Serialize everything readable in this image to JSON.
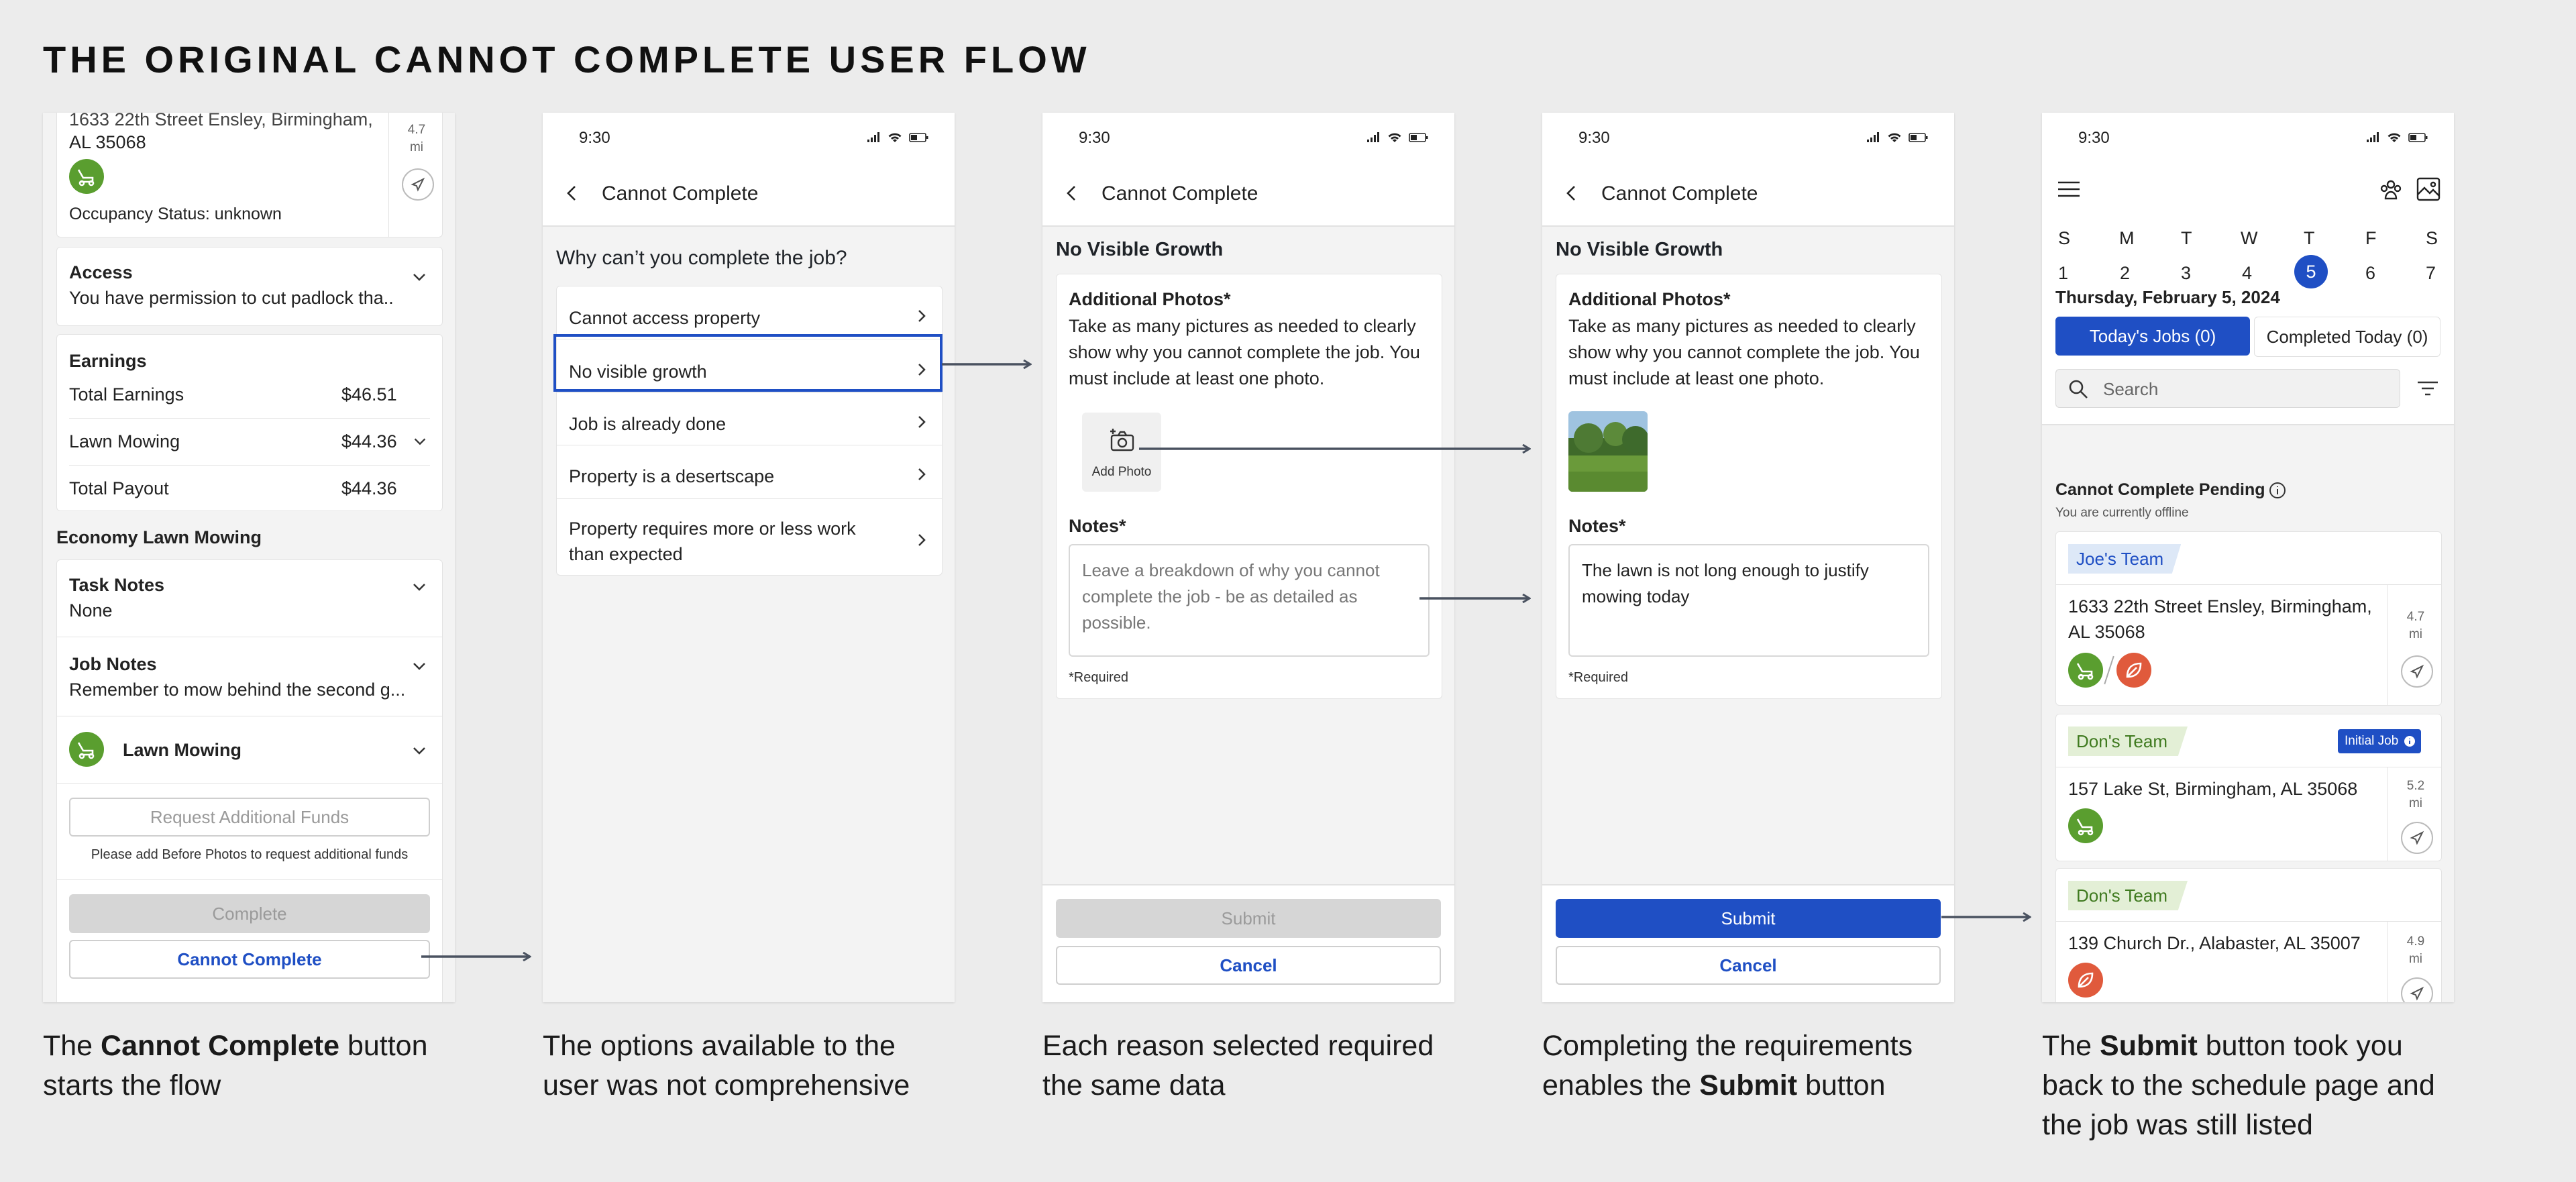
{
  "page": {
    "title": "THE ORIGINAL CANNOT COMPLETE USER FLOW"
  },
  "colors": {
    "primary": "#1f4fc4",
    "green": "#5a9e2f",
    "red": "#e05a3c",
    "highlight_border": "#1f4fc4",
    "team_tag": "#dde8f7",
    "team_tag_green": "#e3efd6"
  },
  "screen1": {
    "address_line1": "1633 22th Street Ensley, Birmingham,",
    "address_line2": "AL 35068",
    "distance_value": "4.7",
    "distance_unit": "mi",
    "occupancy": "Occupancy Status: unknown",
    "access_title": "Access",
    "access_text": "You have permission to cut padlock tha..",
    "earnings_title": "Earnings",
    "earnings": [
      {
        "label": "Total Earnings",
        "value": "$46.51"
      },
      {
        "label": "Lawn Mowing",
        "value": "$44.36"
      },
      {
        "label": "Total Payout",
        "value": "$44.36"
      }
    ],
    "section_title": "Economy Lawn Mowing",
    "task_notes_title": "Task Notes",
    "task_notes_text": "None",
    "job_notes_title": "Job Notes",
    "job_notes_text": "Remember to mow behind the second g...",
    "service_label": "Lawn Mowing",
    "request_funds_label": "Request Additional Funds",
    "request_funds_hint": "Please add Before Photos to request additional funds",
    "complete_label": "Complete",
    "cannot_complete_label": "Cannot Complete"
  },
  "screen2": {
    "time": "9:30",
    "header_title": "Cannot Complete",
    "question": "Why can’t you complete the job?",
    "options": [
      "Cannot access property",
      "No visible growth",
      "Job is already done",
      "Property is a desertscape",
      "Property requires more or less work",
      "than expected"
    ]
  },
  "screen3": {
    "time": "9:30",
    "header_title": "Cannot Complete",
    "reason_title": "No Visible Growth",
    "photos_title": "Additional Photos*",
    "photos_text_1": "Take as many pictures as needed to clearly",
    "photos_text_2": "show why you cannot complete the job. You",
    "photos_text_3": "must include at least one photo.",
    "add_photo_label": "Add Photo",
    "notes_title": "Notes*",
    "notes_placeholder_1": "Leave a breakdown of why you cannot",
    "notes_placeholder_2": "complete the job - be as detailed as",
    "notes_placeholder_3": "possible.",
    "required_label": "*Required",
    "submit_label": "Submit",
    "cancel_label": "Cancel"
  },
  "screen4": {
    "time": "9:30",
    "header_title": "Cannot Complete",
    "reason_title": "No Visible Growth",
    "photos_title": "Additional Photos*",
    "photos_text_1": "Take as many pictures as needed to clearly",
    "photos_text_2": "show why you cannot complete the job. You",
    "photos_text_3": "must include at least one photo.",
    "notes_title": "Notes*",
    "notes_value_1": "The lawn is not long enough to justify",
    "notes_value_2": "mowing today",
    "required_label": "*Required",
    "submit_label": "Submit",
    "cancel_label": "Cancel"
  },
  "screen5": {
    "time": "9:30",
    "weekdays": [
      "S",
      "M",
      "T",
      "W",
      "T",
      "F",
      "S"
    ],
    "days": [
      "1",
      "2",
      "3",
      "4",
      "5",
      "6",
      "7"
    ],
    "selected_day_index": 4,
    "date_label": "Thursday, February 5, 2024",
    "tab_today": "Today's Jobs (0)",
    "tab_completed": "Completed Today (0)",
    "search_placeholder": "Search",
    "pending_title": "Cannot Complete Pending",
    "offline_text": "You are currently offline",
    "jobs": [
      {
        "team": "Joe's Team",
        "address_1": "1633 22th Street Ensley, Birmingham,",
        "address_2": "AL 35068",
        "distance_value": "4.7",
        "distance_unit": "mi"
      },
      {
        "team": "Don's Team",
        "badge": "Initial Job",
        "address_1": "157 Lake St, Birmingham, AL 35068",
        "distance_value": "5.2",
        "distance_unit": "mi"
      },
      {
        "team": "Don's Team",
        "address_1": "139 Church Dr., Alabaster, AL 35007",
        "distance_value": "4.9",
        "distance_unit": "mi"
      }
    ]
  },
  "captions": {
    "c1_pre": "The ",
    "c1_bold": "Cannot Complete",
    "c1_post": " button",
    "c1_line2": "starts the flow",
    "c2_line1": "The options available to the",
    "c2_line2": "user was not comprehensive",
    "c3_line1": "Each reason selected required",
    "c3_line2": "the same data",
    "c4_line1": "Completing the requirements",
    "c4_pre": "enables the ",
    "c4_bold": "Submit",
    "c4_post": " button",
    "c5_pre": "The ",
    "c5_bold": "Submit",
    "c5_post": " button took you",
    "c5_line2": "back to the schedule page and",
    "c5_line3": "the job was still listed"
  }
}
